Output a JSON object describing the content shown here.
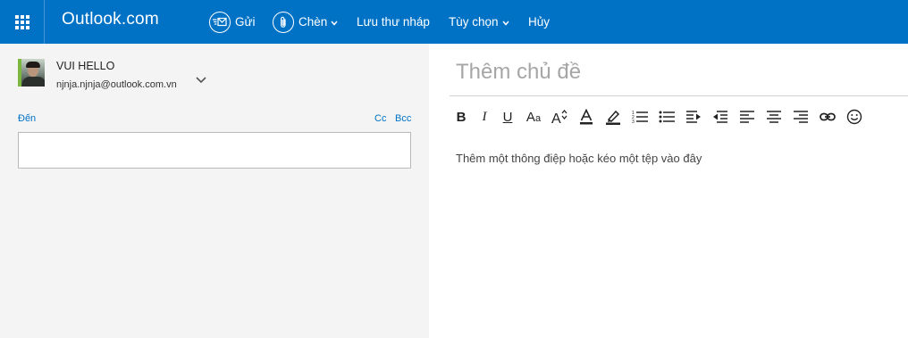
{
  "topbar": {
    "brand": "Outlook.com",
    "send_label": "Gửi",
    "insert_label": "Chèn",
    "save_draft_label": "Lưu thư nháp",
    "options_label": "Tùy chọn",
    "cancel_label": "Hủy",
    "background_color": "#0072c6"
  },
  "sender": {
    "name": "VUI HELLO",
    "email": "njnja.njnja@outlook.com.vn"
  },
  "recipients": {
    "to_label": "Đến",
    "cc_label": "Cc",
    "bcc_label": "Bcc",
    "to_value": ""
  },
  "compose": {
    "subject_placeholder": "Thêm chủ đề",
    "subject_value": "",
    "body_placeholder": "Thêm một thông điệp hoặc kéo một tệp vào đây"
  },
  "toolbar_icons": [
    "bold-icon",
    "italic-icon",
    "underline-icon",
    "font-size-icon",
    "grow-font-icon",
    "font-color-icon",
    "highlight-icon",
    "numbered-list-icon",
    "bulleted-list-icon",
    "decrease-indent-icon",
    "increase-indent-icon",
    "align-left-icon",
    "align-center-icon",
    "align-right-icon",
    "link-icon",
    "emoji-icon"
  ]
}
